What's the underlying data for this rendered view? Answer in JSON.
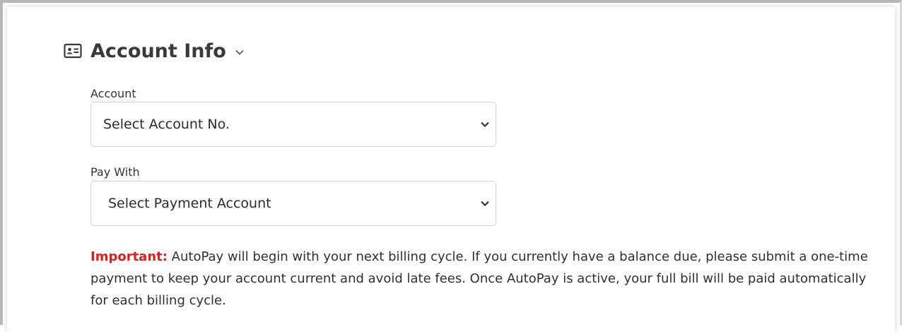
{
  "section": {
    "title": "Account Info",
    "icon": "id-card-icon",
    "toggle_icon": "chevron-down-icon"
  },
  "account_field": {
    "label": "Account",
    "selected": "Select Account No."
  },
  "pay_with_field": {
    "label": "Pay With",
    "selected": "Select Payment Account"
  },
  "notice": {
    "label": "Important:",
    "text": " AutoPay will begin with your next billing cycle. If you currently have a balance due, please submit a one-time payment to keep your account current and avoid late fees. Once AutoPay is active, your full bill will be paid automatically for each billing cycle."
  },
  "colors": {
    "important": "#e31b1b",
    "text": "#2f2f2f",
    "border": "#d3d3d3"
  }
}
